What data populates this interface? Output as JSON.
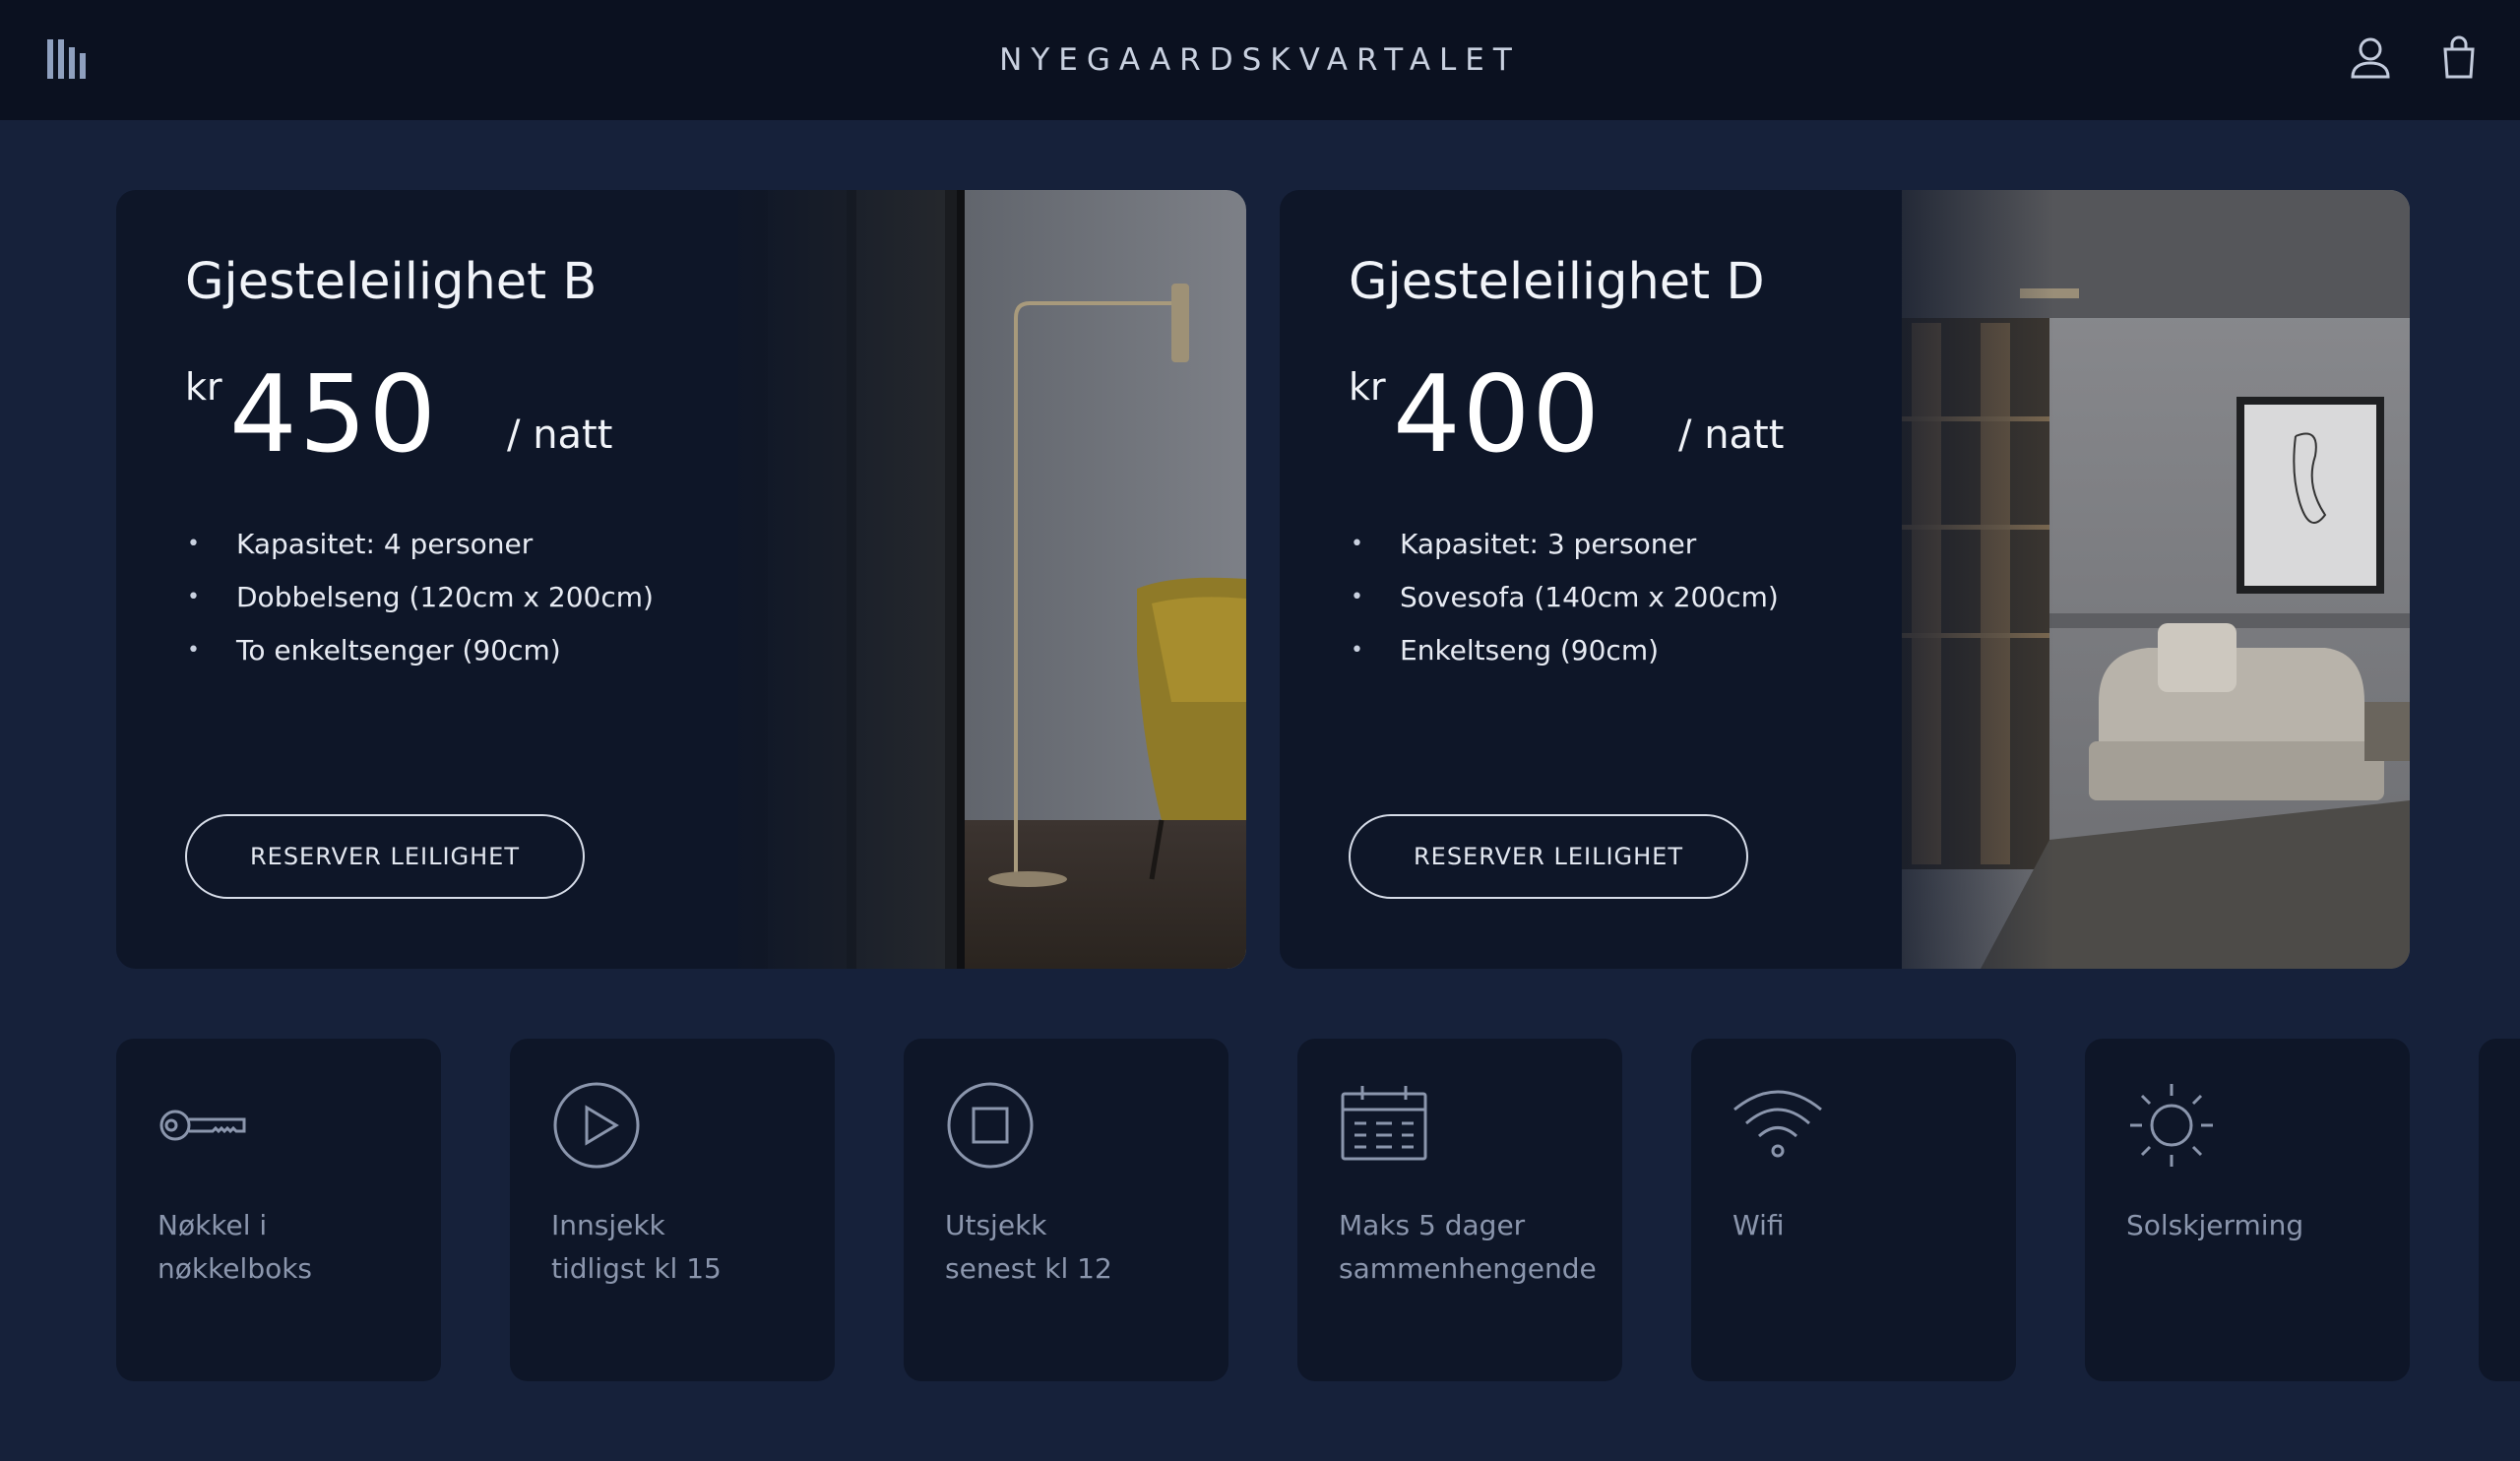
{
  "header": {
    "brand": "NYEGAARDSKVARTALET",
    "menu_icon": "menu-bars-icon",
    "user_icon": "user-icon",
    "bag_icon": "shopping-bag-icon"
  },
  "apartments": [
    {
      "title": "Gjesteleilighet B",
      "currency": "kr",
      "price": "450",
      "unit": "/ natt",
      "features": [
        "Kapasitet: 4 personer",
        "Dobbelseng (120cm x 200cm)",
        "To enkeltsenger (90cm)"
      ],
      "button": "RESERVER LEILIGHET"
    },
    {
      "title": "Gjesteleilighet D",
      "currency": "kr",
      "price": "400",
      "unit": "/ natt",
      "features": [
        "Kapasitet: 3 personer",
        "Sovesofa (140cm x 200cm)",
        "Enkeltseng (90cm)"
      ],
      "button": "RESERVER LEILIGHET"
    }
  ],
  "amenities": [
    {
      "icon": "key-icon",
      "label": "Nøkkel i\nnøkkelboks"
    },
    {
      "icon": "play-circle-icon",
      "label": "Innsjekk\ntidligst kl 15"
    },
    {
      "icon": "stop-circle-icon",
      "label": "Utsjekk\nsenest kl 12"
    },
    {
      "icon": "calendar-icon",
      "label": "Maks 5 dager\nsammenhengende"
    },
    {
      "icon": "wifi-icon",
      "label": "Wifi"
    },
    {
      "icon": "sun-icon",
      "label": "Solskjerming"
    }
  ],
  "colors": {
    "page_bg": "#16213a",
    "header_bg": "#0b1120",
    "card_bg": "#0e1628",
    "muted_text": "#8b96ad"
  }
}
